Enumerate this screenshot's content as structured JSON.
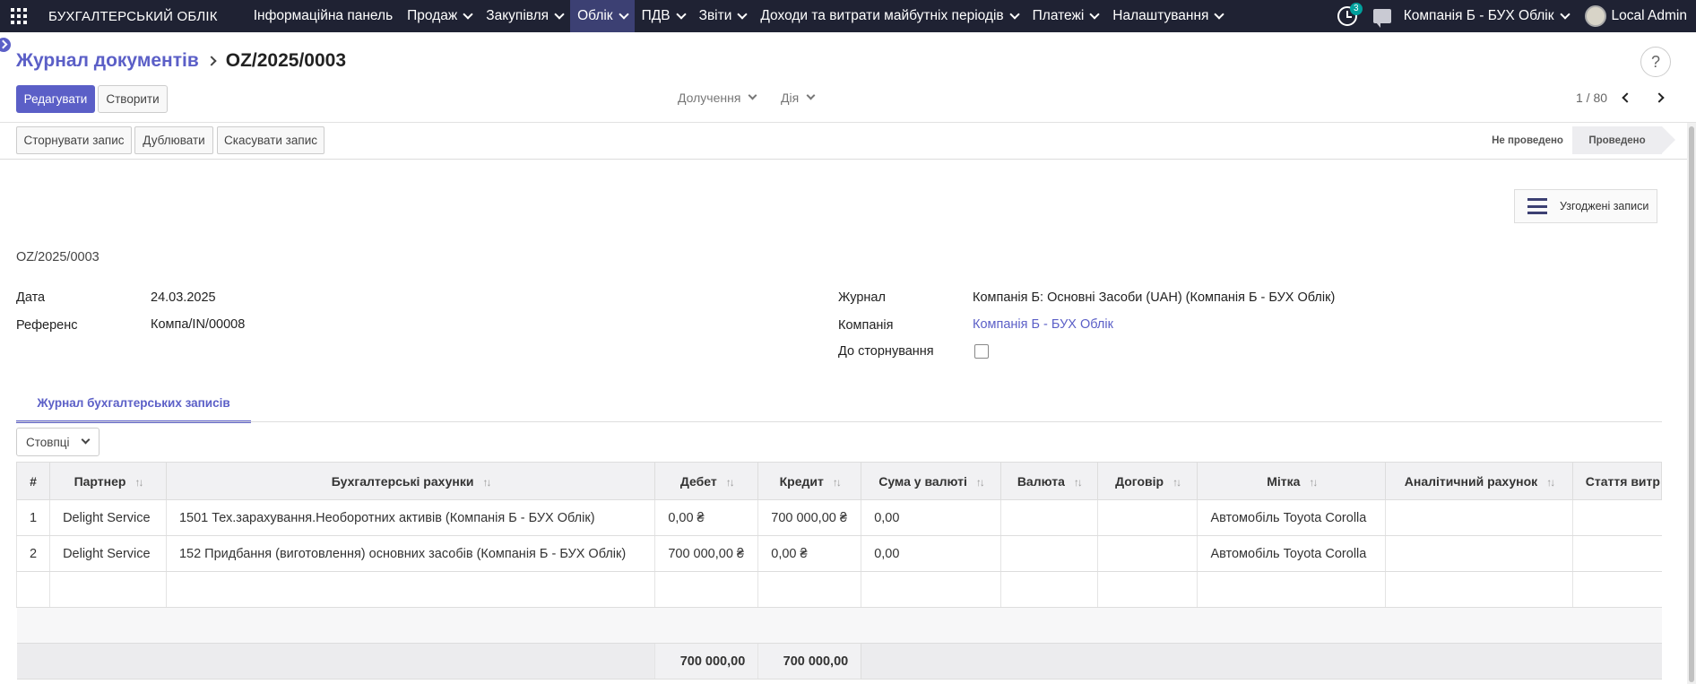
{
  "nav": {
    "brand": "БУХГАЛТЕРСЬКИЙ ОБЛІК",
    "menu": [
      {
        "label": "Інформаційна панель",
        "caret": false,
        "active": false
      },
      {
        "label": "Продаж",
        "caret": true,
        "active": false
      },
      {
        "label": "Закупівля",
        "caret": true,
        "active": false
      },
      {
        "label": "Облік",
        "caret": true,
        "active": true
      },
      {
        "label": "ПДВ",
        "caret": true,
        "active": false
      },
      {
        "label": "Звіти",
        "caret": true,
        "active": false
      },
      {
        "label": "Доходи та витрати майбутніх періодів",
        "caret": true,
        "active": false
      },
      {
        "label": "Платежі",
        "caret": true,
        "active": false
      },
      {
        "label": "Налаштування",
        "caret": true,
        "active": false
      }
    ],
    "activity_badge": "3",
    "company": "Компанія Б - БУХ Облік",
    "user": "Local Admin"
  },
  "breadcrumb": {
    "parent": "Журнал документів",
    "current": "OZ/2025/0003"
  },
  "help": "?",
  "buttons": {
    "edit": "Редагувати",
    "create": "Створити"
  },
  "actions": {
    "attach": "Долучення",
    "action": "Дія"
  },
  "pager": {
    "value": "1 / 80"
  },
  "statusbar": {
    "buttons": [
      "Сторнувати запис",
      "Дублювати",
      "Скасувати запис"
    ],
    "stages": [
      "Не проведено",
      "Проведено"
    ],
    "current_stage": "Проведено"
  },
  "smart_button": {
    "label": "Узгоджені записи",
    "icon": "list-icon"
  },
  "form": {
    "name": "OZ/2025/0003",
    "date_label": "Дата",
    "date_value": "24.03.2025",
    "ref_label": "Референс",
    "ref_value": "Компа/IN/00008",
    "journal_label": "Журнал",
    "journal_value": "Компанія Б: Основні Засоби (UAH) (Компанія Б - БУХ Облік)",
    "company_label": "Компанія",
    "company_value": "Компанія Б - БУХ Облік",
    "reverse_label": "До сторнування",
    "reverse_checked": false
  },
  "tab": {
    "label": "Журнал бухгалтерських записів"
  },
  "columns_button": "Стовпці",
  "table": {
    "headers": [
      "#",
      "Партнер",
      "Бухгалтерські рахунки",
      "Дебет",
      "Кредит",
      "Сума у валюті",
      "Валюта",
      "Договір",
      "Мітка",
      "Аналітичний рахунок",
      "Стаття витр"
    ],
    "rows": [
      [
        "1",
        "Delight Service",
        "1501 Тех.зарахування.Необоротних активів (Компанія Б - БУХ Облік)",
        "0,00 ₴",
        "700 000,00 ₴",
        "0,00",
        "",
        "",
        "Автомобіль Toyota Corolla",
        "",
        ""
      ],
      [
        "2",
        "Delight Service",
        "152 Придбання (виготовлення) основних засобів (Компанія Б - БУХ Облік)",
        "700 000,00 ₴",
        "0,00 ₴",
        "0,00",
        "",
        "",
        "Автомобіль Toyota Corolla",
        "",
        ""
      ]
    ],
    "totals": {
      "debit": "700 000,00",
      "credit": "700 000,00"
    }
  },
  "colors": {
    "navbar": "#1f2233",
    "accent": "#5b5fc7",
    "active_menu": "#3c4073"
  }
}
